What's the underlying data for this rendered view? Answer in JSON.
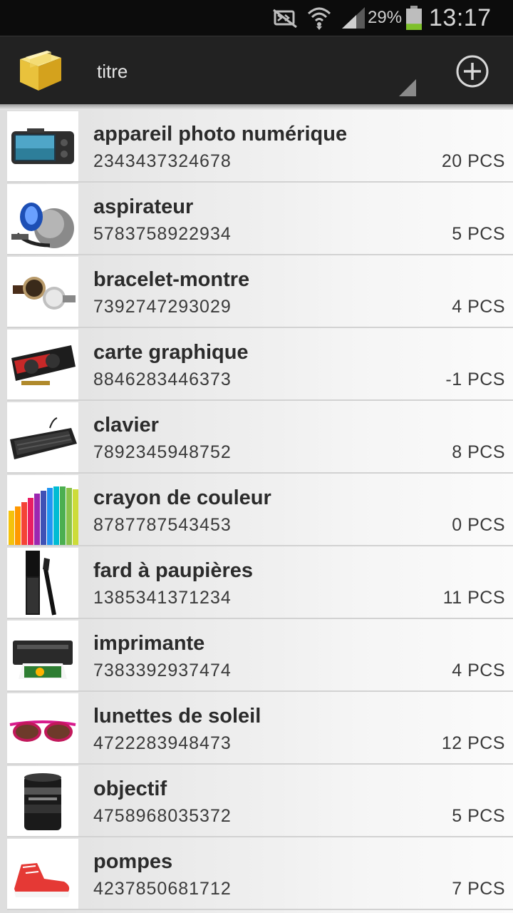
{
  "status_bar": {
    "battery_percent": "29%",
    "battery_level": 0.29,
    "clock": "13:17",
    "icons": [
      "mute-icon",
      "wifi-icon",
      "signal-icon",
      "battery-icon"
    ]
  },
  "action_bar": {
    "logo_icon": "package-box-icon",
    "spinner_value": "titre",
    "add_icon": "add-circle-icon"
  },
  "products": [
    {
      "name": "appareil photo numérique",
      "code": "2343437324678",
      "qty": "20 PCS",
      "icon": "camera-icon"
    },
    {
      "name": "aspirateur",
      "code": "5783758922934",
      "qty": "5 PCS",
      "icon": "vacuum-icon"
    },
    {
      "name": "bracelet-montre",
      "code": "7392747293029",
      "qty": "4 PCS",
      "icon": "watch-icon"
    },
    {
      "name": "carte graphique",
      "code": "8846283446373",
      "qty": "-1 PCS",
      "icon": "graphics-card-icon"
    },
    {
      "name": "clavier",
      "code": "7892345948752",
      "qty": "8 PCS",
      "icon": "keyboard-icon"
    },
    {
      "name": "crayon de couleur",
      "code": "8787787543453",
      "qty": "0 PCS",
      "icon": "colored-pencils-icon"
    },
    {
      "name": "fard à paupières",
      "code": "1385341371234",
      "qty": "11 PCS",
      "icon": "mascara-icon"
    },
    {
      "name": "imprimante",
      "code": "7383392937474",
      "qty": "4 PCS",
      "icon": "printer-icon"
    },
    {
      "name": "lunettes de soleil",
      "code": "4722283948473",
      "qty": "12 PCS",
      "icon": "sunglasses-icon"
    },
    {
      "name": "objectif",
      "code": "4758968035372",
      "qty": "5 PCS",
      "icon": "lens-icon"
    },
    {
      "name": "pompes",
      "code": "4237850681712",
      "qty": "7 PCS",
      "icon": "sneakers-icon"
    }
  ]
}
